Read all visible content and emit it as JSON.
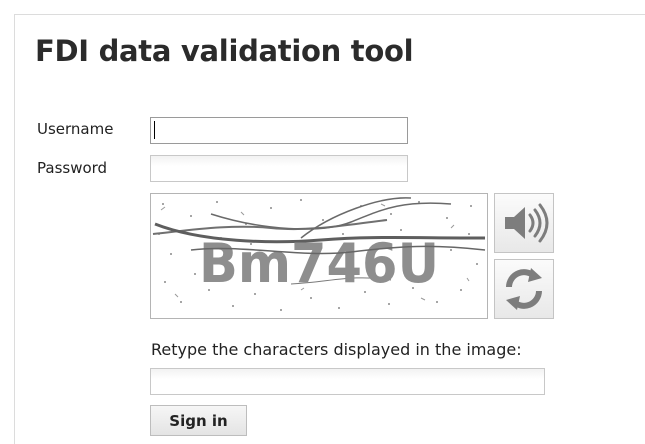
{
  "page": {
    "title": "FDI data validation tool"
  },
  "login": {
    "username_label": "Username",
    "username_value": "",
    "password_label": "Password",
    "password_value": ""
  },
  "captcha": {
    "image_text": "Bm746U",
    "audio_icon": "speaker-icon",
    "refresh_icon": "refresh-icon",
    "retype_label": "Retype the characters displayed in the image:",
    "retype_value": ""
  },
  "actions": {
    "signin_label": "Sign in"
  }
}
